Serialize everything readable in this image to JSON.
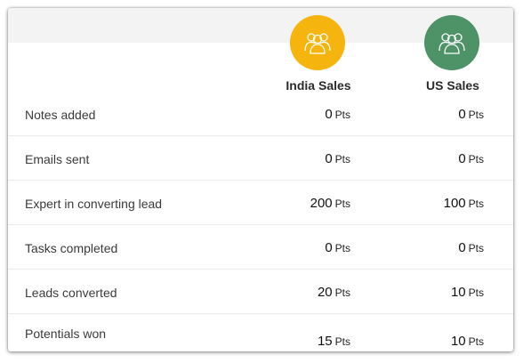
{
  "teams": [
    {
      "name": "India Sales",
      "color": "#f5b40e",
      "icon": "team-icon"
    },
    {
      "name": "US Sales",
      "color": "#4e9268",
      "icon": "team-icon"
    }
  ],
  "unit": "Pts",
  "rows": [
    {
      "label": "Notes added",
      "india": "0",
      "us": "0"
    },
    {
      "label": "Emails sent",
      "india": "0",
      "us": "0"
    },
    {
      "label": "Expert in converting lead",
      "india": "200",
      "us": "100"
    },
    {
      "label": "Tasks completed",
      "india": "0",
      "us": "0"
    },
    {
      "label": "Leads converted",
      "india": "20",
      "us": "10"
    },
    {
      "label": "Potentials won",
      "india": "15",
      "us": "10"
    }
  ]
}
